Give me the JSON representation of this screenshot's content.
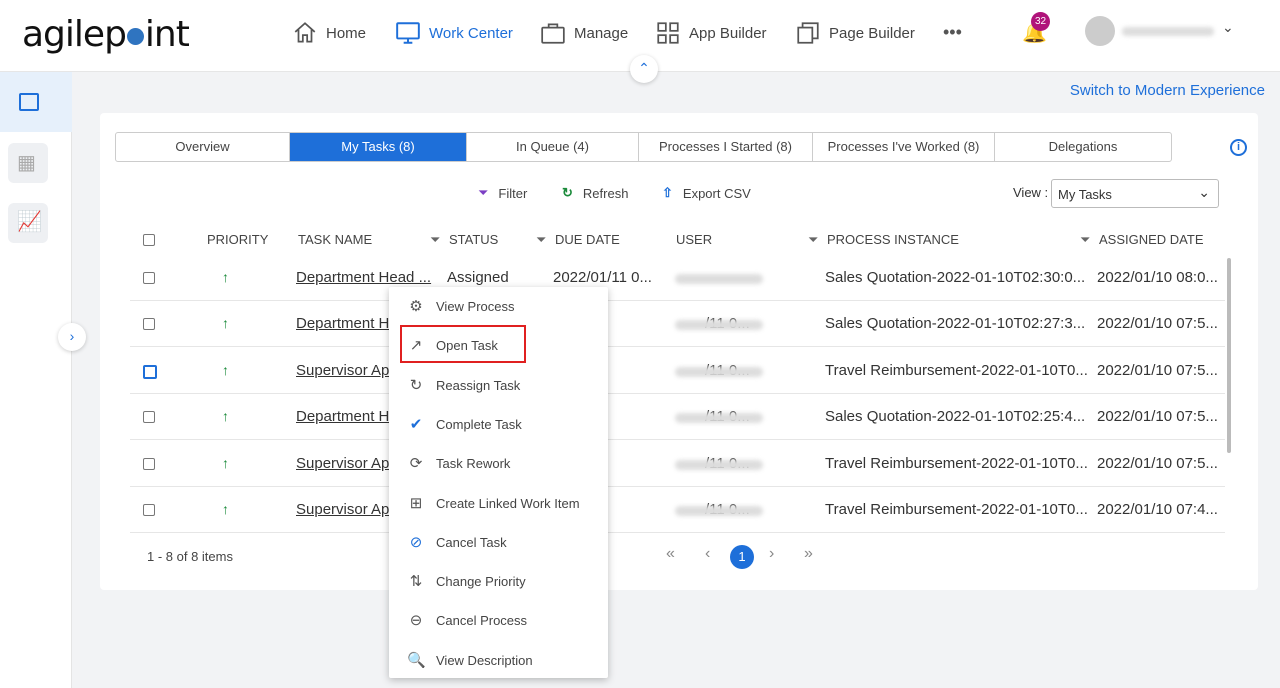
{
  "brand": "agilepoint",
  "nav": [
    {
      "label": "Home",
      "icon": "home-icon"
    },
    {
      "label": "Work Center",
      "icon": "monitor-icon",
      "active": true
    },
    {
      "label": "Manage",
      "icon": "briefcase-icon"
    },
    {
      "label": "App Builder",
      "icon": "grid-icon"
    },
    {
      "label": "Page Builder",
      "icon": "pages-icon"
    }
  ],
  "more": "•••",
  "notifications": "32",
  "switch_link": "Switch to Modern Experience",
  "tabs": [
    {
      "label": "Overview"
    },
    {
      "label": "My Tasks (8)",
      "active": true
    },
    {
      "label": "In Queue (4)"
    },
    {
      "label": "Processes I Started (8)"
    },
    {
      "label": "Processes I've Worked (8)"
    },
    {
      "label": "Delegations"
    }
  ],
  "toolbar": {
    "filter": "Filter",
    "refresh": "Refresh",
    "export": "Export CSV",
    "view_label": "View :",
    "view_value": "My Tasks"
  },
  "columns": {
    "priority": "PRIORITY",
    "task": "TASK NAME",
    "status": "STATUS",
    "due": "DUE DATE",
    "user": "USER",
    "process": "PROCESS INSTANCE",
    "assigned": "ASSIGNED DATE"
  },
  "rows": [
    {
      "task": "Department Head ...",
      "status": "Assigned",
      "due": "2022/01/11 0...",
      "process": "Sales Quotation-2022-01-10T02:30:0...",
      "assigned": "2022/01/10 08:0..."
    },
    {
      "task": "Department H",
      "status": "",
      "due": "/11 0...",
      "process": "Sales Quotation-2022-01-10T02:27:3...",
      "assigned": "2022/01/10 07:5..."
    },
    {
      "task": "Supervisor Ap",
      "status": "",
      "due": "/11 0...",
      "process": "Travel Reimbursement-2022-01-10T0...",
      "assigned": "2022/01/10 07:5..."
    },
    {
      "task": "Department H",
      "status": "",
      "due": "/11 0...",
      "process": "Sales Quotation-2022-01-10T02:25:4...",
      "assigned": "2022/01/10 07:5..."
    },
    {
      "task": "Supervisor Ap",
      "status": "",
      "due": "/11 0...",
      "process": "Travel Reimbursement-2022-01-10T0...",
      "assigned": "2022/01/10 07:5..."
    },
    {
      "task": "Supervisor Ap",
      "status": "",
      "due": "/11 0...",
      "process": "Travel Reimbursement-2022-01-10T0...",
      "assigned": "2022/01/10 07:4..."
    }
  ],
  "pagination": {
    "summary": "1 - 8 of 8 items",
    "first": "«",
    "prev": "‹",
    "page": "1",
    "next": "›",
    "last": "»"
  },
  "context_menu": [
    {
      "label": "View Process",
      "icon": "view-process-icon",
      "glyph": "⚙"
    },
    {
      "label": "Open Task",
      "icon": "open-external-icon",
      "glyph": "↗",
      "highlighted": true
    },
    {
      "label": "Reassign Task",
      "icon": "reassign-icon",
      "glyph": "↻"
    },
    {
      "label": "Complete Task",
      "icon": "check-icon",
      "glyph": "✔"
    },
    {
      "label": "Task Rework",
      "icon": "rework-icon",
      "glyph": "⟳"
    },
    {
      "label": "Create Linked Work Item",
      "icon": "linked-item-icon",
      "glyph": "⊞"
    },
    {
      "label": "Cancel Task",
      "icon": "cancel-icon",
      "glyph": "⊘"
    },
    {
      "label": "Change Priority",
      "icon": "priority-swap-icon",
      "glyph": "⇅"
    },
    {
      "label": "Cancel Process",
      "icon": "minus-circle-icon",
      "glyph": "⊖"
    },
    {
      "label": "View Description",
      "icon": "zoom-icon",
      "glyph": "🔍"
    }
  ],
  "colors": {
    "accent": "#1e6fd9",
    "priority": "#1a8a3a",
    "highlight": "#e02020",
    "badge": "#b0137a"
  }
}
